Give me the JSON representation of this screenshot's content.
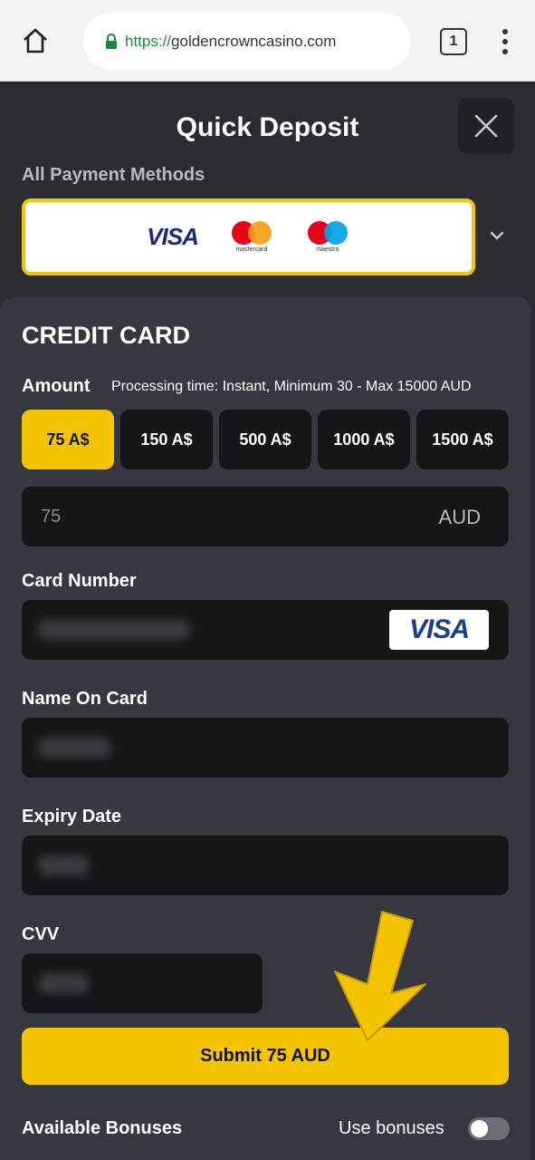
{
  "browser": {
    "url_scheme": "https://",
    "url_host": "goldencrowncasino.com",
    "tab_count": "1"
  },
  "header": {
    "title": "Quick Deposit",
    "methods_label": "All Payment Methods",
    "method_logos": {
      "visa": "VISA",
      "mastercard_caption": "mastercard",
      "maestro_caption": "maestro"
    }
  },
  "form": {
    "section_title": "CREDIT CARD",
    "amount_label": "Amount",
    "processing_note": "Processing time: Instant, Minimum 30 - Max 15000 AUD",
    "amount_options": [
      "75 A$",
      "150 A$",
      "500 A$",
      "1000 A$",
      "1500 A$"
    ],
    "selected_amount_index": 0,
    "amount_value": "75",
    "amount_currency": "AUD",
    "card_number_label": "Card Number",
    "card_brand": "VISA",
    "name_label": "Name On Card",
    "expiry_label": "Expiry Date",
    "cvv_label": "CVV",
    "submit_label": "Submit 75 AUD"
  },
  "bonuses": {
    "label": "Available Bonuses",
    "toggle_label": "Use bonuses",
    "enabled": false
  },
  "colors": {
    "accent": "#f5c400",
    "background": "#2a2c32",
    "panel": "#36383f",
    "field": "#151619"
  }
}
